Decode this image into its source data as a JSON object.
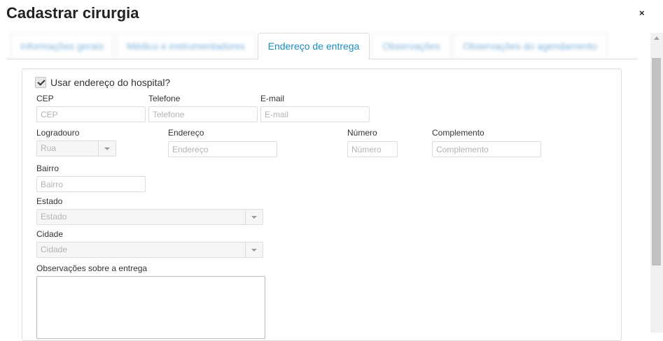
{
  "modal": {
    "title": "Cadastrar cirurgia",
    "close_label": "×"
  },
  "tabs": [
    {
      "label": "Informações gerais"
    },
    {
      "label": "Médico e instrumentadores"
    },
    {
      "label": "Endereço de entrega"
    },
    {
      "label": "Observações"
    },
    {
      "label": "Observações do agendamento"
    }
  ],
  "form": {
    "use_hospital_address": {
      "label": "Usar endereço do hospital?",
      "checked": true
    },
    "cep": {
      "label": "CEP",
      "placeholder": "CEP",
      "value": ""
    },
    "telefone": {
      "label": "Telefone",
      "placeholder": "Telefone",
      "value": ""
    },
    "email": {
      "label": "E-mail",
      "placeholder": "E-mail",
      "value": ""
    },
    "logradouro": {
      "label": "Logradouro",
      "selected": "Rua"
    },
    "endereco": {
      "label": "Endereço",
      "placeholder": "Endereço",
      "value": ""
    },
    "numero": {
      "label": "Número",
      "placeholder": "Número",
      "value": ""
    },
    "complemento": {
      "label": "Complemento",
      "placeholder": "Complemento",
      "value": ""
    },
    "bairro": {
      "label": "Bairro",
      "placeholder": "Bairro",
      "value": ""
    },
    "estado": {
      "label": "Estado",
      "selected": "Estado"
    },
    "cidade": {
      "label": "Cidade",
      "selected": "Cidade"
    },
    "observacoes": {
      "label": "Observações sobre a entrega",
      "value": ""
    }
  }
}
